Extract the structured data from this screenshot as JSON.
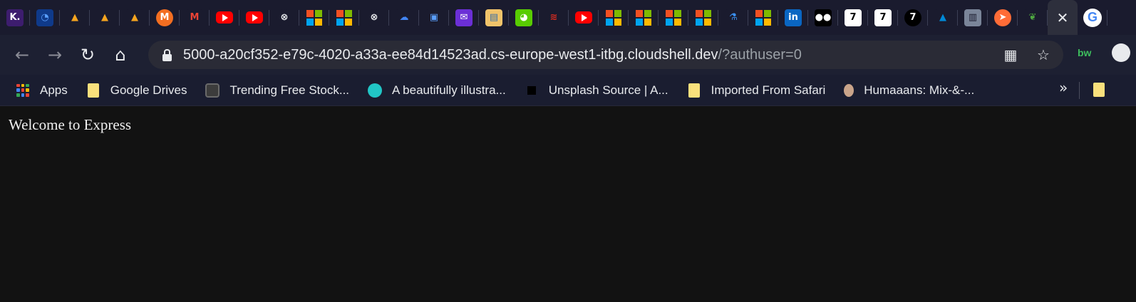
{
  "tabs": [
    {
      "icon": "kaggle-k-icon",
      "glyph": "K.",
      "bg": "#3d1d6e",
      "fg": "#ffffff"
    },
    {
      "icon": "speedometer-icon",
      "glyph": "◔",
      "bg": "#0f3a8a",
      "fg": "#5aa0ff"
    },
    {
      "icon": "turtle-icon",
      "glyph": "▲",
      "bg": "#1a1b2e",
      "fg": "#f4a41f"
    },
    {
      "icon": "turtle-icon",
      "glyph": "▲",
      "bg": "#1a1b2e",
      "fg": "#f4a41f"
    },
    {
      "icon": "turtle-icon",
      "glyph": "▲",
      "bg": "#1a1b2e",
      "fg": "#f4a41f"
    },
    {
      "icon": "m-logo-icon",
      "glyph": "M",
      "bg": "#f36e21",
      "fg": "#ffffff",
      "round": true
    },
    {
      "icon": "gmail-icon",
      "glyph": "M",
      "bg": "#1a1b2e",
      "fg": "#ea4335"
    },
    {
      "icon": "youtube-icon",
      "kind": "yt"
    },
    {
      "icon": "youtube-icon",
      "kind": "yt"
    },
    {
      "icon": "x-logo-icon",
      "glyph": "⊗",
      "bg": "#1a1b2e",
      "fg": "#e8eaed",
      "round": true
    },
    {
      "icon": "microsoft-icon",
      "kind": "ms"
    },
    {
      "icon": "microsoft-icon",
      "kind": "ms"
    },
    {
      "icon": "x-logo-icon",
      "glyph": "⊗",
      "bg": "#1a1b2e",
      "fg": "#e8eaed",
      "round": true
    },
    {
      "icon": "google-cloud-icon",
      "glyph": "☁",
      "bg": "#1a1b2e",
      "fg": "#4285f4"
    },
    {
      "icon": "chip-icon",
      "glyph": "▣",
      "bg": "#1a1b2e",
      "fg": "#5aa0ff"
    },
    {
      "icon": "mail-icon",
      "glyph": "✉",
      "bg": "#6b2fd6",
      "fg": "#ffffff"
    },
    {
      "icon": "box-icon",
      "glyph": "▤",
      "bg": "#f0c36a",
      "fg": "#3a6ea5"
    },
    {
      "icon": "duolingo-icon",
      "glyph": "◕",
      "bg": "#58cc02",
      "fg": "#ffffff"
    },
    {
      "icon": "redis-icon",
      "glyph": "≋",
      "bg": "#1a1b2e",
      "fg": "#d82c20"
    },
    {
      "icon": "youtube-icon",
      "kind": "yt"
    },
    {
      "icon": "microsoft-icon",
      "kind": "ms"
    },
    {
      "icon": "microsoft-icon",
      "kind": "ms"
    },
    {
      "icon": "microsoft-icon",
      "kind": "ms"
    },
    {
      "icon": "microsoft-icon",
      "kind": "ms"
    },
    {
      "icon": "flask-icon",
      "glyph": "⚗",
      "bg": "#1a1b2e",
      "fg": "#3b8ff0"
    },
    {
      "icon": "microsoft-icon",
      "kind": "ms"
    },
    {
      "icon": "linkedin-icon",
      "glyph": "in",
      "bg": "#0a66c2",
      "fg": "#ffffff"
    },
    {
      "icon": "medium-icon",
      "glyph": "●●",
      "bg": "#000000",
      "fg": "#ffffff"
    },
    {
      "icon": "seven-icon",
      "glyph": "7",
      "bg": "#ffffff",
      "fg": "#000000"
    },
    {
      "icon": "seven-icon",
      "glyph": "7",
      "bg": "#ffffff",
      "fg": "#000000"
    },
    {
      "icon": "seven-icon",
      "glyph": "7",
      "bg": "#000000",
      "fg": "#ffffff",
      "round": true
    },
    {
      "icon": "azure-icon",
      "glyph": "▲",
      "bg": "#1a1b2e",
      "fg": "#0089d6"
    },
    {
      "icon": "panel-icon",
      "glyph": "▥",
      "bg": "#7a8599",
      "fg": "#1a1b2e"
    },
    {
      "icon": "postman-icon",
      "glyph": "➤",
      "bg": "#ff6c37",
      "fg": "#ffffff",
      "round": true
    },
    {
      "icon": "mongodb-leaf-icon",
      "glyph": "❦",
      "bg": "#1a1b2e",
      "fg": "#4faa41"
    }
  ],
  "active_tab": {
    "close_glyph": "✕"
  },
  "next_tab": {
    "glyph": "G"
  },
  "toolbar": {
    "back_glyph": "←",
    "forward_glyph": "→",
    "reload_glyph": "↻",
    "home_glyph": "⌂",
    "url_host": "5000-a20cf352-e79c-4020-a33a-ee84d14523ad.cs-europe-west1-itbg.cloudshell.dev",
    "url_path": "/?authuser=0",
    "qr_glyph": "▦",
    "star_glyph": "☆",
    "ext_bw": "bw"
  },
  "bookmarks": {
    "items": [
      {
        "label": "Apps",
        "icon": "apps-grid-icon"
      },
      {
        "label": "Google Drives",
        "icon": "folder-icon"
      },
      {
        "label": "Trending Free Stock...",
        "icon": "camera-icon"
      },
      {
        "label": "A beautifully illustra...",
        "icon": "c-logo-icon"
      },
      {
        "label": "Unsplash Source | A...",
        "icon": "unsplash-icon"
      },
      {
        "label": "Imported From Safari",
        "icon": "folder-icon"
      },
      {
        "label": "Humaaans: Mix-&-...",
        "icon": "humaaans-icon"
      }
    ],
    "more_glyph": "»"
  },
  "page": {
    "heading": "Welcome to Express"
  },
  "colors": {
    "tabstrip": "#1a1b2e",
    "toolbar": "#1d2032",
    "page_bg": "#121212",
    "text": "#e8eaed"
  }
}
